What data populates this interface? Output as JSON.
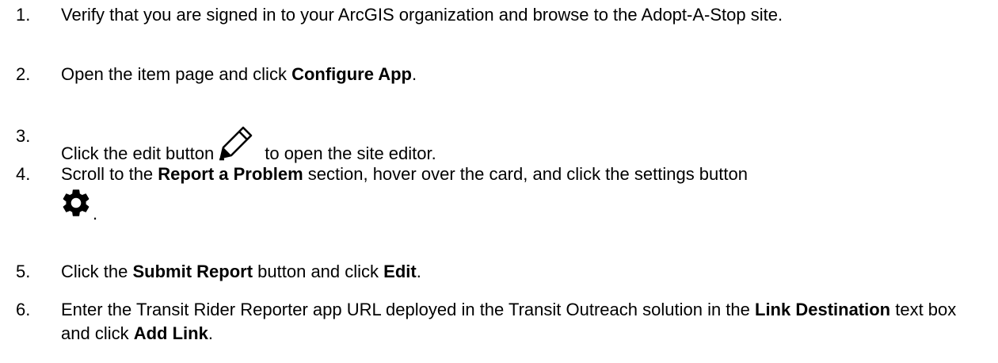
{
  "steps": [
    {
      "number": "1.",
      "text_a": "Verify that you are signed in to your ArcGIS organization and browse to the Adopt-A-Stop site."
    },
    {
      "number": "2.",
      "text_a": "Open the item page and click ",
      "bold_a": "Configure App",
      "text_b": "."
    },
    {
      "number": "3.",
      "text_a": "Click the edit button",
      "icon": "pencil-icon",
      "text_b": "to open the site editor."
    },
    {
      "number": "4.",
      "text_a": "Scroll to the ",
      "bold_a": "Report a Problem",
      "text_b": " section, hover over the card, and click the settings button",
      "icon": "gear-icon",
      "text_c": "."
    },
    {
      "number": "5.",
      "text_a": "Click the ",
      "bold_a": "Submit Report",
      "text_b": " button and click ",
      "bold_b": "Edit",
      "text_c": "."
    },
    {
      "number": "6.",
      "text_a": " Enter the Transit Rider Reporter app URL deployed in the Transit Outreach solution in the ",
      "bold_a": "Link Destination",
      "text_b": " text box and click ",
      "bold_b": "Add Link",
      "text_c": "."
    }
  ]
}
